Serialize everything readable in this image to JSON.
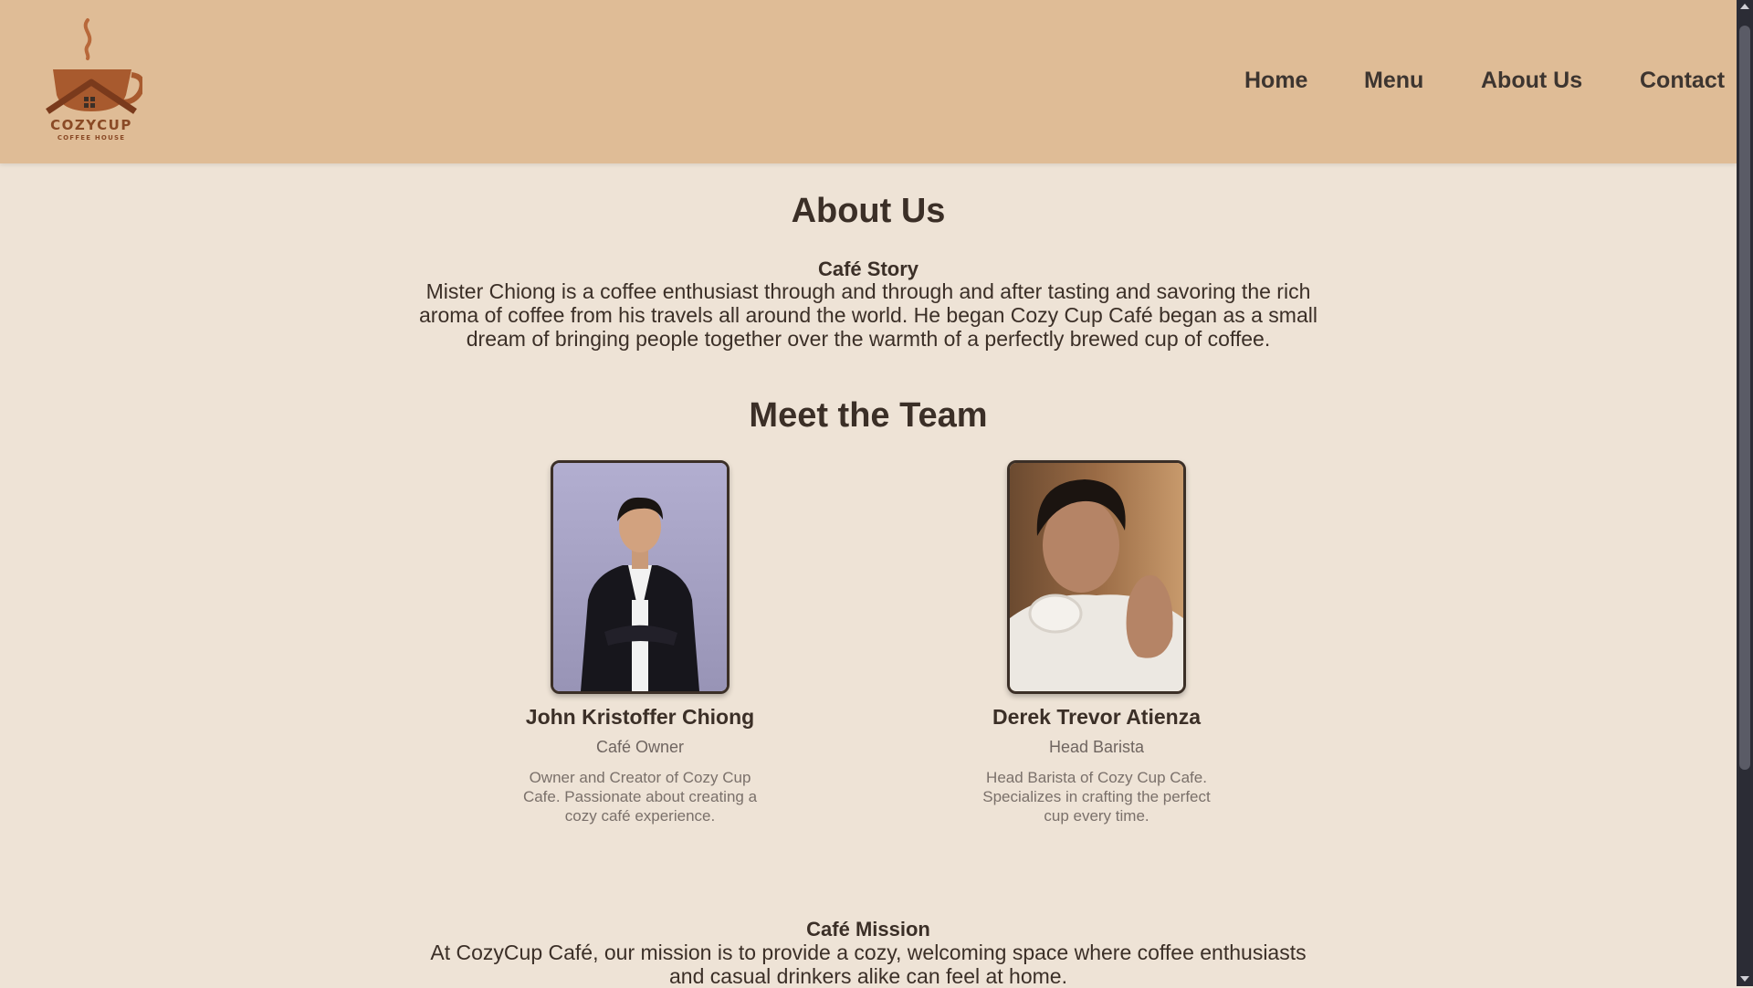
{
  "brand": {
    "name": "COZYCUP",
    "tagline": "COFFEE HOUSE"
  },
  "nav": {
    "items": [
      {
        "label": "Home"
      },
      {
        "label": "Menu"
      },
      {
        "label": "About Us"
      },
      {
        "label": "Contact"
      }
    ]
  },
  "page": {
    "title": "About Us"
  },
  "story": {
    "title": "Café Story",
    "text": "Mister Chiong is a coffee enthusiast through and through and after tasting and savoring the rich aroma of coffee from his travels all around the world. He began Cozy Cup Café began as a small dream of bringing people together over the warmth of a perfectly brewed cup of coffee."
  },
  "team": {
    "title": "Meet the Team",
    "members": [
      {
        "name": "John Kristoffer Chiong",
        "role": "Café Owner",
        "bio": "Owner and Creator of Cozy Cup Cafe. Passionate about creating a cozy café experience."
      },
      {
        "name": "Derek Trevor Atienza",
        "role": "Head Barista",
        "bio": "Head Barista of Cozy Cup Cafe. Specializes in crafting the perfect cup every time."
      }
    ]
  },
  "mission": {
    "title": "Café Mission",
    "text": "At CozyCup Café, our mission is to provide a cozy, welcoming space where coffee enthusiasts and casual drinkers alike can feel at home."
  },
  "colors": {
    "header_bg": "#dfbc96",
    "page_bg": "#eee3d6",
    "text_dark": "#3b2f27",
    "brand_brown": "#8a4a26"
  }
}
